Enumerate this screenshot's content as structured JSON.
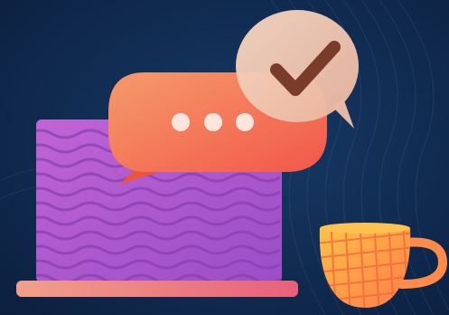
{
  "illustration": {
    "icons": [
      "laptop-icon",
      "chat-bubble-icon",
      "checkmark-icon",
      "coffee-cup-icon"
    ],
    "colors": {
      "background": "#0d2346",
      "laptop_screen": "#b55bd0",
      "laptop_base": "#f08a7e",
      "chat_bubble": "#f4704e",
      "check_bubble": "#f2cdb6",
      "checkmark": "#7a3c2a",
      "cup": "#ffb23e"
    }
  }
}
